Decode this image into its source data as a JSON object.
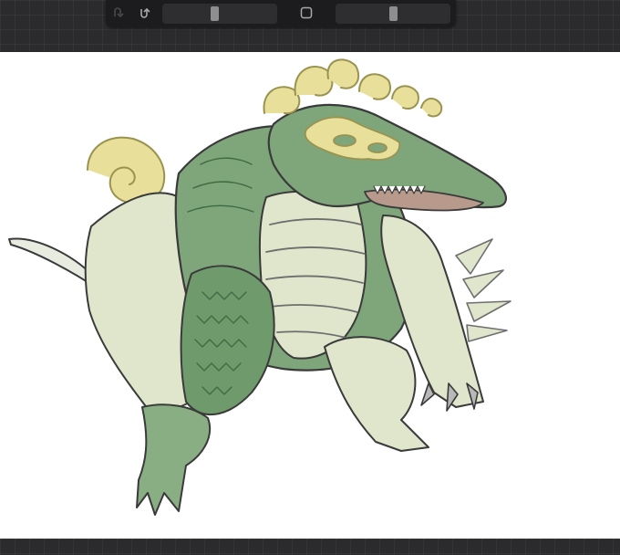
{
  "app": {
    "toolbar": {
      "undo_icon": "undo-icon",
      "redo_icon": "redo-icon",
      "shape_icon": "square-icon",
      "brush_size": 0.45,
      "brush_opacity": 0.5
    },
    "artwork": {
      "subject": "green-lizard-monster-sketch",
      "colors": {
        "body_green": "#7fa57a",
        "pale_green": "#dfe6cc",
        "scales_dark": "#6f9b6c",
        "crest_yellow": "#e8e09a",
        "outline": "#3a3a3a"
      }
    },
    "theme": {
      "chrome_bg": "#2b2b2d",
      "toolbar_bg": "#1c1c1e",
      "canvas_bg": "#ffffff"
    }
  }
}
